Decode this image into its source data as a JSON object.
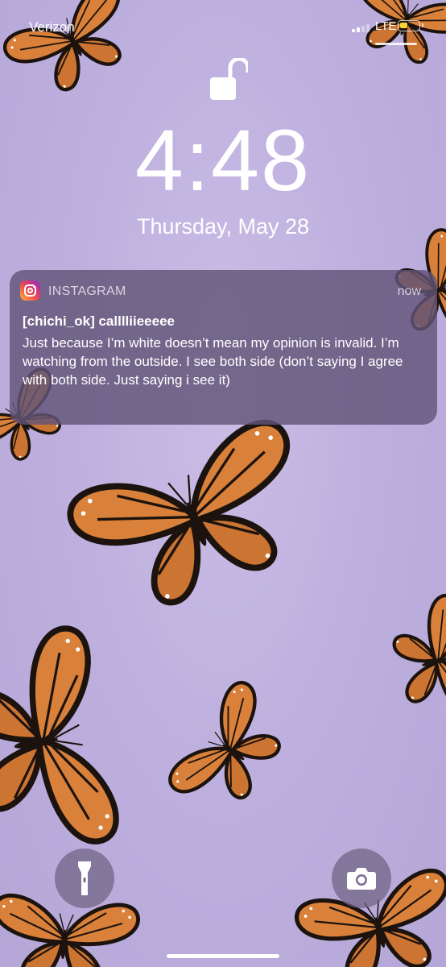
{
  "status_bar": {
    "carrier": "Verizon",
    "network": "LTE",
    "battery_level": 0.45,
    "battery_color": "#f5d633"
  },
  "lock_screen": {
    "lock_icon": "unlocked-padlock-icon",
    "time": "4:48",
    "date": "Thursday, May 28"
  },
  "notification": {
    "app_icon": "instagram-icon",
    "app_name": "INSTAGRAM",
    "timestamp": "now",
    "title": "[chichi_ok] calllliieeeee",
    "body": "Just because I’m white doesn’t mean my opinion is invalid. I’m watching from the outside. I see both side (don’t saying I agree with both side. Just saying i see it)"
  },
  "quick_actions": {
    "flashlight_icon": "flashlight-icon",
    "camera_icon": "camera-icon"
  },
  "colors": {
    "wallpaper_lavender": "#bcaedd",
    "butterfly_orange": "#d9813a",
    "notification_bg": "#625478"
  }
}
